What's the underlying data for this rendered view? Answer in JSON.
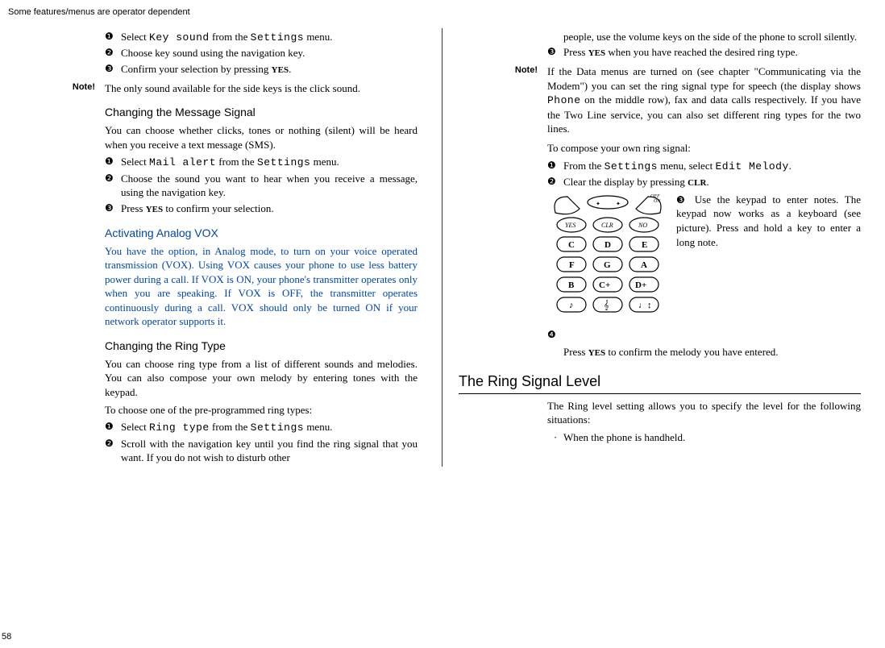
{
  "header": "Some features/menus are operator dependent",
  "page": "58",
  "left": {
    "steps1": {
      "s1a": "Select ",
      "s1_lcd1": "Key sound",
      "s1b": " from the ",
      "s1_lcd2": "Settings",
      "s1c": " menu.",
      "s2": "Choose key sound using the navigation key.",
      "s3a": "Confirm your selection by pressing ",
      "s3_sc": "YES",
      "s3b": "."
    },
    "note1": {
      "label": "Note!",
      "body": "The only sound available for the side keys is the click sound."
    },
    "h2a": "Changing the Message Signal",
    "p1": "You can choose whether clicks, tones or nothing (silent) will be heard when you receive a text message (SMS).",
    "steps2": {
      "s1a": "Select ",
      "s1_lcd1": "Mail alert",
      "s1b": " from the ",
      "s1_lcd2": "Settings",
      "s1c": " menu.",
      "s2": "Choose the sound you want to hear when you receive a message, using the navigation key.",
      "s3a": "Press ",
      "s3_sc": "YES",
      "s3b": " to confirm your selection."
    },
    "h2b": "Activating Analog VOX",
    "p2": "You have the option, in Analog mode, to turn on your voice operated transmission (VOX). Using VOX causes your phone to use less battery power during a call. If VOX is ON, your phone's transmitter operates only when you are speaking.  If VOX is OFF, the transmitter operates continuously during a call. VOX should only be turned ON if your network operator supports it.",
    "h2c": "Changing the Ring Type",
    "p3": "You can choose ring type from a list of different sounds and melodies. You can also compose your own melody by entering tones with the keypad.",
    "p4": "To choose one of the pre-programmed ring types:",
    "steps3": {
      "s1a": "Select ",
      "s1_lcd1": "Ring type",
      "s1b": " from the ",
      "s1_lcd2": "Settings",
      "s1c": " menu.",
      "s2": "Scroll with the navigation key until you find the ring signal that you want. If you do not wish to disturb other"
    }
  },
  "right": {
    "cont": "people, use the volume keys on the side of the phone to scroll silently.",
    "s3a": "Press ",
    "s3_sc": "YES",
    "s3b": " when you have reached the desired ring type.",
    "note2": {
      "label": "Note!",
      "body_a": "If the Data menus are turned on (see chapter \"Communicating via the Modem\") you can set the ring signal type for speech (the display shows ",
      "body_lcd": "Phone",
      "body_b": " on the middle row), fax and data calls respectively. If you have the Two Line service, you can also set different ring types for the two lines."
    },
    "p5": "To compose your own ring signal:",
    "steps4": {
      "s1a": "From the ",
      "s1_lcd1": "Settings",
      "s1b": " menu, select ",
      "s1_lcd2": "Edit Melody",
      "s1c": ".",
      "s2a": "Clear the display by pressing ",
      "s2_sc": "CLR",
      "s2b": ".",
      "s3": "Use the keypad to enter notes. The keypad now works as a keyboard (see picture). Press and hold a key to enter a long note.",
      "s4a": "Press ",
      "s4_sc": "YES",
      "s4b": " to confirm the melody you have entered."
    },
    "h1": "The Ring Signal Level",
    "p6": "The Ring level setting allows you to specify the level for the following situations:",
    "dot1": "When the phone is handheld."
  },
  "bullets": {
    "b1": "❶",
    "b2": "❷",
    "b3": "❸",
    "b4": "❹"
  }
}
